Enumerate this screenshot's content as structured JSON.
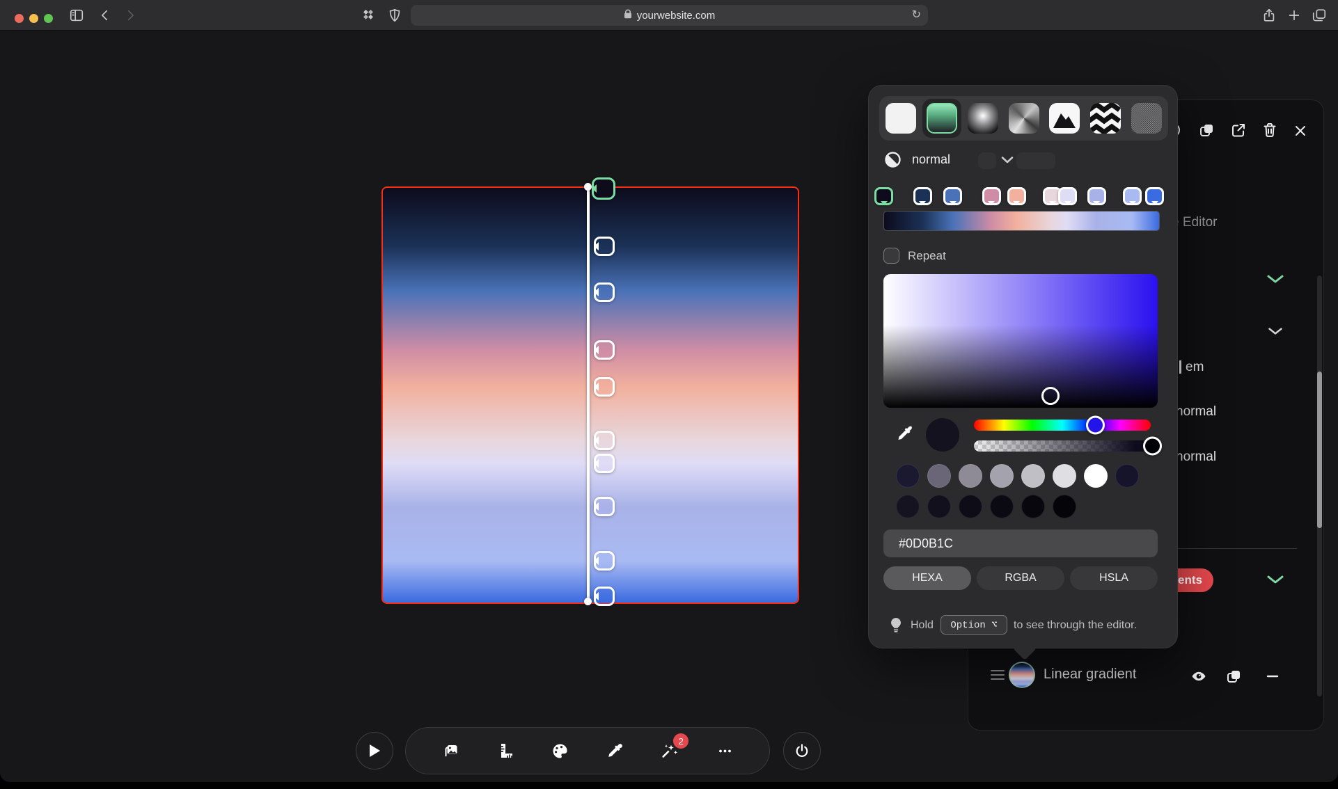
{
  "browser": {
    "url": "yourwebsite.com"
  },
  "gradient": {
    "stops": [
      {
        "color": "#0D0B1C",
        "pos": 0,
        "selected": true
      },
      {
        "color": "#1B3156",
        "pos": 14
      },
      {
        "color": "#4A72B8",
        "pos": 25
      },
      {
        "color": "#CE8DA5",
        "pos": 39
      },
      {
        "color": "#F2B09E",
        "pos": 48
      },
      {
        "color": "#E8D7DD",
        "pos": 61
      },
      {
        "color": "#DFDCF6",
        "pos": 66.5
      },
      {
        "color": "#A9B2E8",
        "pos": 77
      },
      {
        "color": "#A9BAF3",
        "pos": 90
      },
      {
        "color": "#3B6BE0",
        "pos": 100
      }
    ]
  },
  "picker_popup": {
    "fill_types": [
      {
        "name": "solid"
      },
      {
        "name": "linear-gradient",
        "selected": true
      },
      {
        "name": "radial-gradient"
      },
      {
        "name": "conic-gradient"
      },
      {
        "name": "image"
      },
      {
        "name": "pattern"
      },
      {
        "name": "noise"
      }
    ],
    "blend_mode": "normal",
    "repeat_label": "Repeat",
    "hex_value": "#0D0B1C",
    "current_color": "#14121F",
    "hue_percent": 68.5,
    "alpha_percent": 100,
    "formats": [
      {
        "label": "HEXA",
        "active": true
      },
      {
        "label": "RGBA",
        "active": false
      },
      {
        "label": "HSLA",
        "active": false
      }
    ],
    "swatches_row1": [
      "#1B1930",
      "#6A6678",
      "#8E8B97",
      "#A4A2AC",
      "#C0BFC6",
      "#DFDFE3",
      "#FFFFFF",
      "#16142B"
    ],
    "swatches_row2": [
      "#15131F",
      "#12101C",
      "#0E0C17",
      "#0B0A13",
      "#08070E",
      "#050409"
    ],
    "hint": {
      "prefix": "Hold",
      "key": "Option ⌥",
      "suffix": "to see through the editor."
    }
  },
  "side_panel": {
    "title_partial": "e Editor",
    "field_partial": "em",
    "value_1": "normal",
    "value_2": "normal",
    "badge_partial": "ients",
    "layer_name": "Linear gradient"
  },
  "toolbar": {
    "notification_count": "2"
  },
  "colors": {
    "accent_green": "#7CDDA2",
    "danger_red": "#E5484D",
    "selection_red": "#FB2D15"
  }
}
